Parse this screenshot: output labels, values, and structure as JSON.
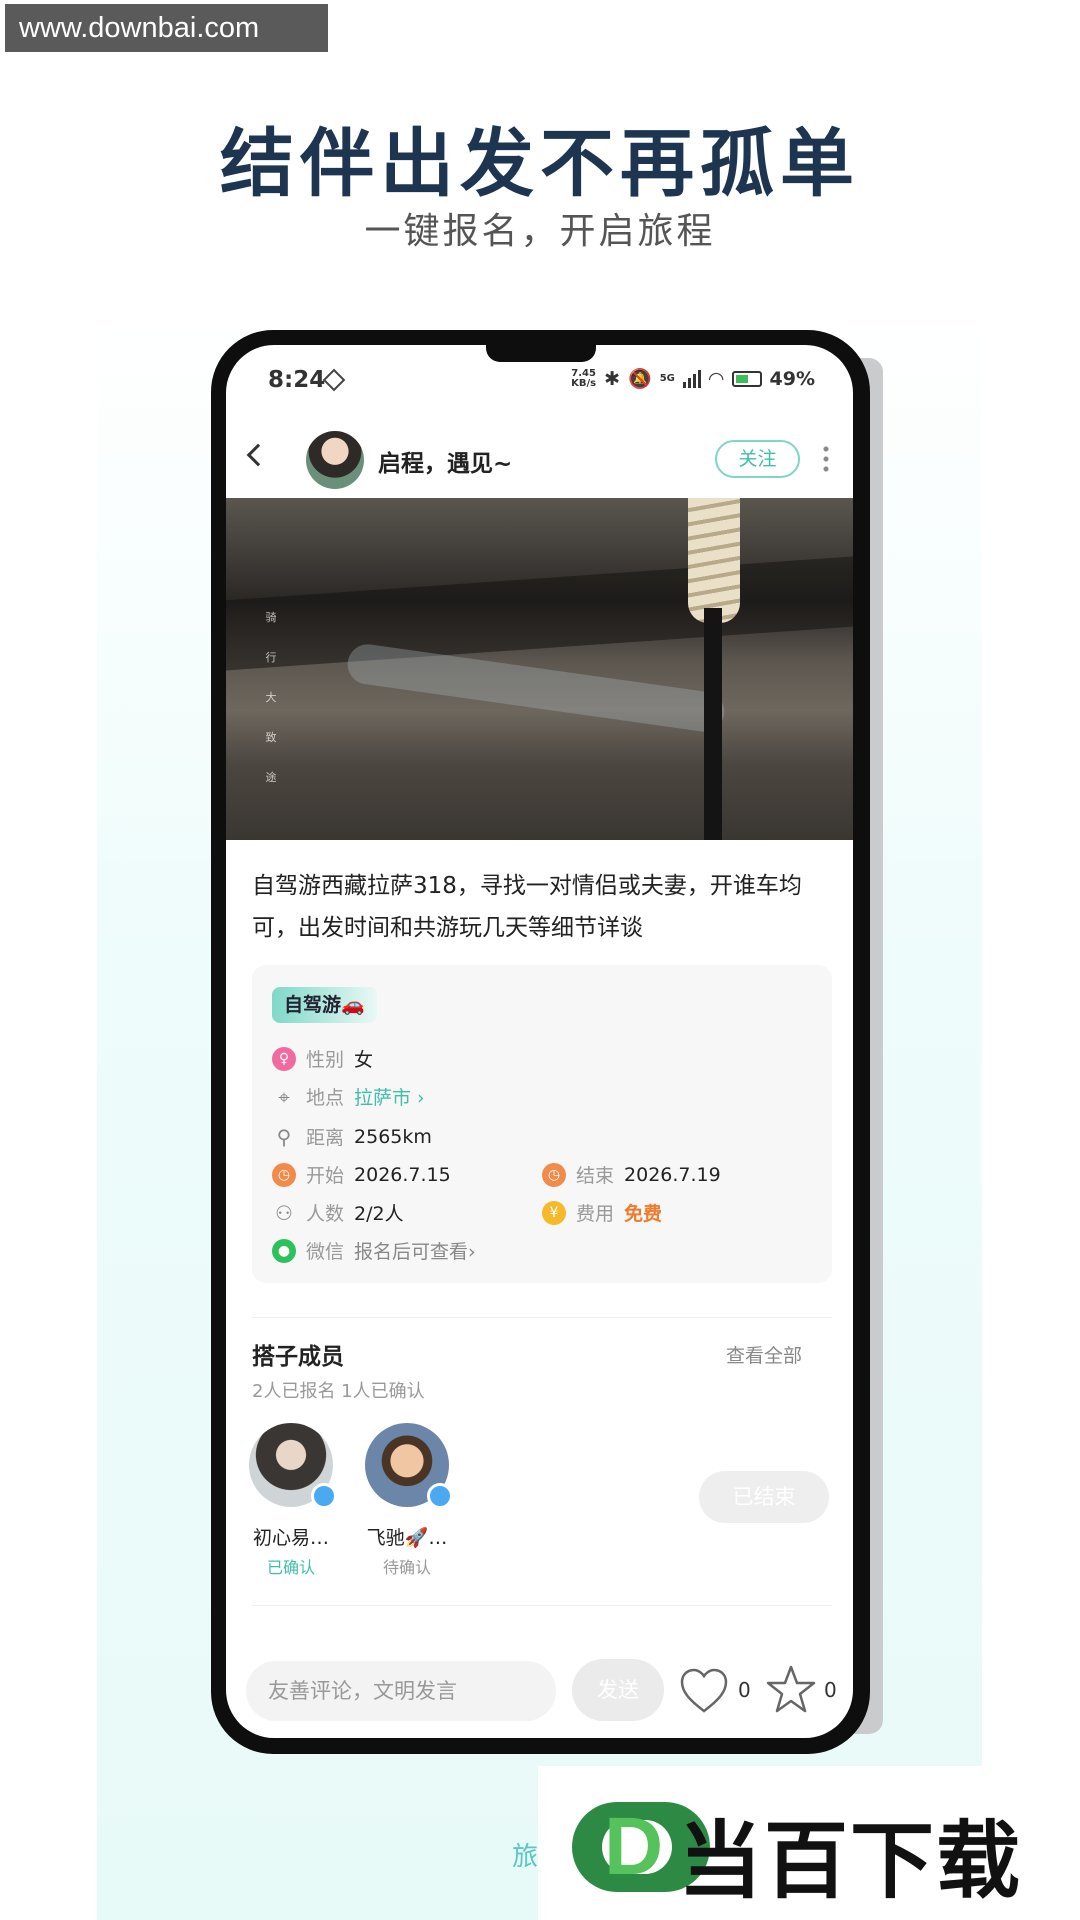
{
  "watermark": "www.downbai.com",
  "headline": "结伴出发不再孤单",
  "subline": "一键报名，开启旅程",
  "status_bar": {
    "time": "8:24",
    "speed_top": "7.45",
    "speed_bottom": "KB/s",
    "network": "5G",
    "battery": "49%"
  },
  "header": {
    "username": "启程，遇见~",
    "follow_label": "关注"
  },
  "photo": {
    "vertical_text": "骑 行 大 致 途"
  },
  "post": {
    "description": "自驾游西藏拉萨318，寻找一对情侣或夫妻，开谁车均可，出发时间和共游玩几天等细节详谈"
  },
  "info": {
    "tag": "自驾游🚗",
    "gender_label": "性别",
    "gender_value": "女",
    "location_label": "地点",
    "location_value": "拉萨市 ›",
    "distance_label": "距离",
    "distance_value": "2565km",
    "start_label": "开始",
    "start_value": "2026.7.15",
    "end_label": "结束",
    "end_value": "2026.7.19",
    "people_label": "人数",
    "people_value": "2/2人",
    "cost_label": "费用",
    "cost_value": "免费",
    "wechat_label": "微信",
    "wechat_value": "报名后可查看›"
  },
  "members": {
    "title": "搭子成员",
    "view_all": "查看全部",
    "summary": "2人已报名 1人已确认",
    "list": [
      {
        "name": "初心易…",
        "status": "已确认"
      },
      {
        "name": "飞驰🚀…",
        "status": "待确认"
      }
    ],
    "ended_label": "已结束"
  },
  "bottom_bar": {
    "comment_placeholder": "友善评论，文明发言",
    "send_label": "发送",
    "like_count": "0",
    "fav_count": "0"
  },
  "footer": {
    "partial_text": "旅",
    "logo_letter": "D",
    "logo_text": "当百下载"
  },
  "colors": {
    "accent": "#3fbfa9",
    "headline": "#1d3550",
    "free": "#f07a2b"
  }
}
